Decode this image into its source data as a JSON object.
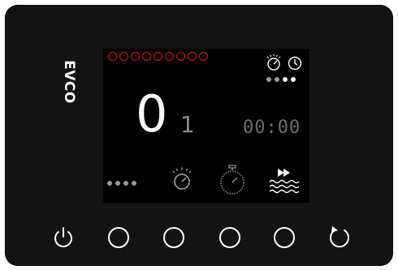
{
  "brand": {
    "logo_text": "EVCO"
  },
  "display": {
    "led_count": 9,
    "main_value": "0",
    "secondary_value": "1",
    "timer": "00:00",
    "top_right_dots": [
      false,
      false,
      true,
      true
    ],
    "bottom_left_dots": [
      false,
      false,
      false,
      false
    ]
  },
  "colors": {
    "panel": "#141414",
    "screen": "#000000",
    "led_ring": "#e01818",
    "main_value": "#ffffff",
    "secondary_value": "#8c8c8c",
    "timer": "#6e6e6e"
  },
  "buttons": [
    {
      "name": "power-button",
      "icon": "power-icon"
    },
    {
      "name": "button-1",
      "icon": "circle-icon"
    },
    {
      "name": "button-2",
      "icon": "circle-icon"
    },
    {
      "name": "button-3",
      "icon": "circle-icon"
    },
    {
      "name": "button-4",
      "icon": "circle-icon"
    },
    {
      "name": "reset-button",
      "icon": "refresh-icon"
    }
  ],
  "icons": {
    "status_top": [
      "gauge-icon",
      "clock-icon"
    ],
    "status_bottom": [
      "gauge-icon",
      "stopwatch-icon",
      "fast-forward-water-icon"
    ]
  }
}
